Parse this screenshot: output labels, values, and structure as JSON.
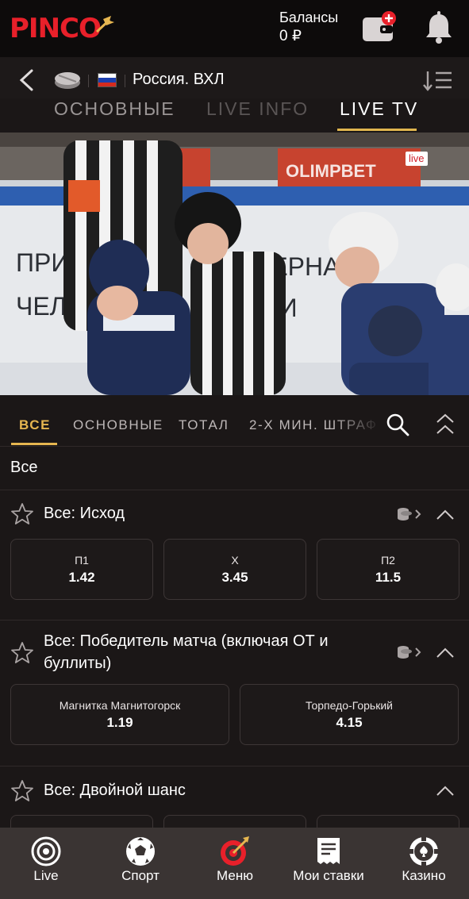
{
  "header": {
    "logo_text": "PINCO",
    "balance_label": "Балансы",
    "balance_value": "0 ₽",
    "brand_color": "#e8202a"
  },
  "event": {
    "league": "Россия. ВХЛ",
    "country_flag": "russia-flag-icon"
  },
  "section_tabs": [
    {
      "label": "ОСНОВНЫЕ",
      "active": false
    },
    {
      "label": "LIVE INFO",
      "active": false
    },
    {
      "label": "LIVE TV",
      "active": true
    }
  ],
  "video": {
    "live_badge": "live"
  },
  "market_tabs": [
    {
      "label": "ВСЕ",
      "active": true
    },
    {
      "label": "ОСНОВНЫЕ",
      "active": false
    },
    {
      "label": "ТОТАЛ",
      "active": false
    },
    {
      "label": "2-Х МИН. ШТРАФ",
      "active": false
    }
  ],
  "filter_label": "Все",
  "markets": [
    {
      "title": "Все: Исход",
      "outcomes": [
        {
          "label": "П1",
          "value": "1.42"
        },
        {
          "label": "X",
          "value": "3.45"
        },
        {
          "label": "П2",
          "value": "11.5"
        }
      ]
    },
    {
      "title_line1": "Все: Победитель матча (включая ОТ и",
      "title_line2": "буллиты)",
      "outcomes": [
        {
          "label": "Магнитка Магнитогорск",
          "value": "1.19"
        },
        {
          "label": "Торпедо-Горький",
          "value": "4.15"
        }
      ]
    },
    {
      "title": "Все: Двойной шанс",
      "outcomes": []
    }
  ],
  "bottom_nav": [
    {
      "label": "Live",
      "icon": "live-icon"
    },
    {
      "label": "Спорт",
      "icon": "soccer-ball-icon"
    },
    {
      "label": "Меню",
      "icon": "menu-target-icon"
    },
    {
      "label": "Мои ставки",
      "icon": "bets-receipt-icon"
    },
    {
      "label": "Казино",
      "icon": "casino-chip-icon"
    }
  ],
  "colors": {
    "accent": "#e6b650",
    "background": "#1b1717",
    "nav_background": "#3a3433"
  }
}
